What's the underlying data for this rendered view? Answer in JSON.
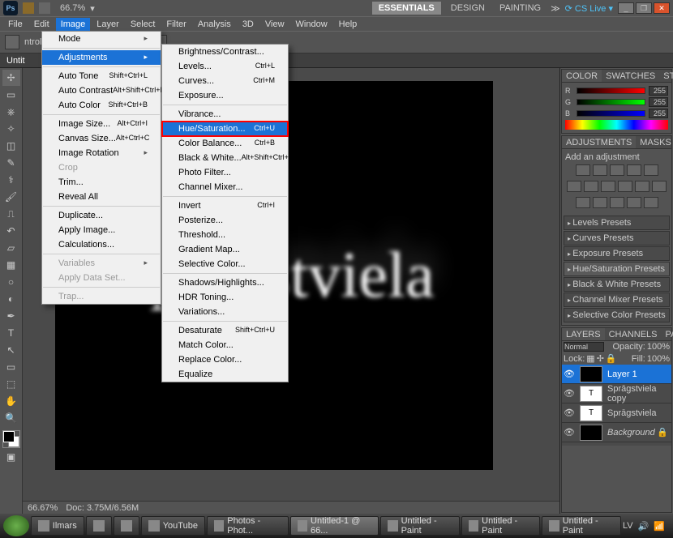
{
  "header": {
    "zoom": "66.7%",
    "workspace": {
      "essentials": "ESSENTIALS",
      "design": "DESIGN",
      "painting": "PAINTING"
    },
    "cslive": "CS Live"
  },
  "menubar": [
    "File",
    "Edit",
    "Image",
    "Layer",
    "Select",
    "Filter",
    "Analysis",
    "3D",
    "View",
    "Window",
    "Help"
  ],
  "optbar": {
    "ntrols": "ntrols"
  },
  "doctab": "Untit",
  "imageMenu": {
    "mode": "Mode",
    "adjustments": "Adjustments",
    "autoTone": {
      "l": "Auto Tone",
      "s": "Shift+Ctrl+L"
    },
    "autoContrast": {
      "l": "Auto Contrast",
      "s": "Alt+Shift+Ctrl+L"
    },
    "autoColor": {
      "l": "Auto Color",
      "s": "Shift+Ctrl+B"
    },
    "imageSize": {
      "l": "Image Size...",
      "s": "Alt+Ctrl+I"
    },
    "canvasSize": {
      "l": "Canvas Size...",
      "s": "Alt+Ctrl+C"
    },
    "imageRotation": "Image Rotation",
    "crop": "Crop",
    "trim": "Trim...",
    "revealAll": "Reveal All",
    "duplicate": "Duplicate...",
    "applyImage": "Apply Image...",
    "calculations": "Calculations...",
    "variables": "Variables",
    "applyDataSet": "Apply Data Set...",
    "trap": "Trap..."
  },
  "adjMenu": {
    "brightContrast": "Brightness/Contrast...",
    "levels": {
      "l": "Levels...",
      "s": "Ctrl+L"
    },
    "curves": {
      "l": "Curves...",
      "s": "Ctrl+M"
    },
    "exposure": "Exposure...",
    "vibrance": "Vibrance...",
    "hueSat": {
      "l": "Hue/Saturation...",
      "s": "Ctrl+U"
    },
    "colorBalance": {
      "l": "Color Balance...",
      "s": "Ctrl+B"
    },
    "blackWhite": {
      "l": "Black & White...",
      "s": "Alt+Shift+Ctrl+B"
    },
    "photoFilter": "Photo Filter...",
    "channelMixer": "Channel Mixer...",
    "invert": {
      "l": "Invert",
      "s": "Ctrl+I"
    },
    "posterize": "Posterize...",
    "threshold": "Threshold...",
    "gradientMap": "Gradient Map...",
    "selectiveColor": "Selective Color...",
    "shadowsHighlights": "Shadows/Highlights...",
    "hdrToning": "HDR Toning...",
    "variations": "Variations...",
    "desaturate": {
      "l": "Desaturate",
      "s": "Shift+Ctrl+U"
    },
    "matchColor": "Match Color...",
    "replaceColor": "Replace Color...",
    "equalize": "Equalize"
  },
  "canvasText": "Sprāgstviela",
  "colorPanel": {
    "tabs": [
      "COLOR",
      "SWATCHES",
      "STYLES"
    ],
    "r": {
      "l": "R",
      "v": "255"
    },
    "g": {
      "l": "G",
      "v": "255"
    },
    "b": {
      "l": "B",
      "v": "255"
    }
  },
  "adjPanel": {
    "tabs": [
      "ADJUSTMENTS",
      "MASKS"
    ],
    "label": "Add an adjustment"
  },
  "presets": [
    "Levels Presets",
    "Curves Presets",
    "Exposure Presets",
    "Hue/Saturation Presets",
    "Black & White Presets",
    "Channel Mixer Presets",
    "Selective Color Presets"
  ],
  "layersPanel": {
    "tabs": [
      "LAYERS",
      "CHANNELS",
      "PATHS"
    ],
    "blend": "Normal",
    "opacityLbl": "Opacity:",
    "opacity": "100%",
    "lockLbl": "Lock:",
    "fillLbl": "Fill:",
    "fill": "100%",
    "layers": [
      {
        "name": "Layer 1",
        "sel": true,
        "thumb": "img"
      },
      {
        "name": "Sprāgstviela copy",
        "sel": false,
        "thumb": "T"
      },
      {
        "name": "Sprāgstviela",
        "sel": false,
        "thumb": "T"
      },
      {
        "name": "Background",
        "sel": false,
        "thumb": "img",
        "bg": true
      }
    ]
  },
  "statusbar": {
    "zoom": "66.67%",
    "doc": "Doc: 3.75M/6.56M"
  },
  "taskbar": {
    "items": [
      "Ilmars",
      "",
      "",
      "YouTube",
      "Photos - Phot...",
      "Untitled-1 @ 66...",
      "Untitled - Paint",
      "Untitled - Paint",
      "Untitled - Paint"
    ],
    "lang": "LV"
  }
}
